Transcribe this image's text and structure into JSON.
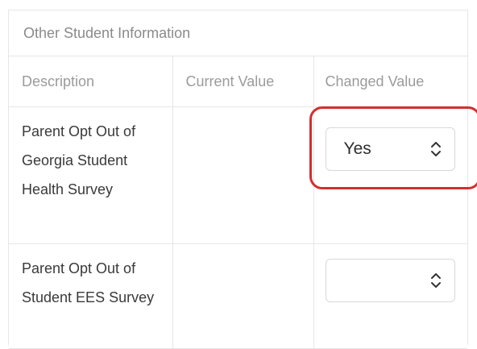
{
  "panel": {
    "title": "Other Student Information"
  },
  "table": {
    "headers": {
      "description": "Description",
      "current": "Current Value",
      "changed": "Changed Value"
    },
    "rows": [
      {
        "description": "Parent Opt Out of Georgia Student Health Survey",
        "current_value": "",
        "changed_value": "Yes"
      },
      {
        "description": "Parent Opt Out of Student EES Survey",
        "current_value": "",
        "changed_value": ""
      }
    ]
  },
  "annotation": {
    "color": "#d32f2f",
    "target": "row-1-changed-value-select"
  },
  "icons": {
    "select_chevron": "up-down-chevron-icon"
  }
}
